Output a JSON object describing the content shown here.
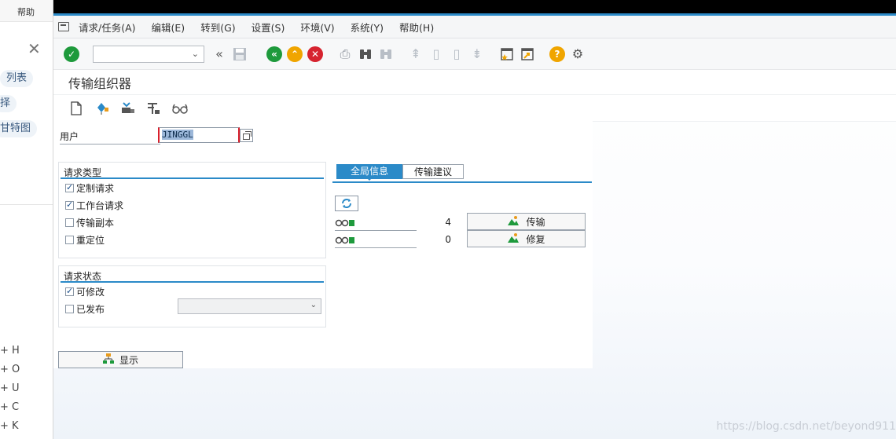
{
  "left_pane": {
    "help": "帮助",
    "chips": [
      "列表",
      "择",
      "甘特图"
    ],
    "tree": [
      "+ H",
      "+ O",
      "+ U",
      "+ C",
      "+ K"
    ]
  },
  "menu": [
    "请求/任务(A)",
    "编辑(E)",
    "转到(G)",
    "设置(S)",
    "环境(V)",
    "系统(Y)",
    "帮助(H)"
  ],
  "page_title": "传输组织器",
  "user": {
    "label": "用户",
    "value": "JINGGL"
  },
  "request_type": {
    "title": "请求类型",
    "items": [
      {
        "label": "定制请求",
        "checked": true
      },
      {
        "label": "工作台请求",
        "checked": true
      },
      {
        "label": "传输副本",
        "checked": false
      },
      {
        "label": "重定位",
        "checked": false
      }
    ]
  },
  "request_status": {
    "title": "请求状态",
    "items": [
      {
        "label": "可修改",
        "checked": true
      },
      {
        "label": "已发布",
        "checked": false
      }
    ]
  },
  "tabs": {
    "global": "全局信息",
    "suggest": "传输建议"
  },
  "stats": [
    {
      "value": "4",
      "action": "传输"
    },
    {
      "value": "0",
      "action": "修复"
    }
  ],
  "display_button": "显示",
  "watermark": "https://blog.csdn.net/beyond911",
  "colors": {
    "accent": "#2b8ac8",
    "ok_green": "#1e9a3c",
    "back_green": "#1e9a3c",
    "exit_orange": "#f0a500",
    "cancel_red": "#d6232f",
    "help_orange": "#f0a500"
  }
}
